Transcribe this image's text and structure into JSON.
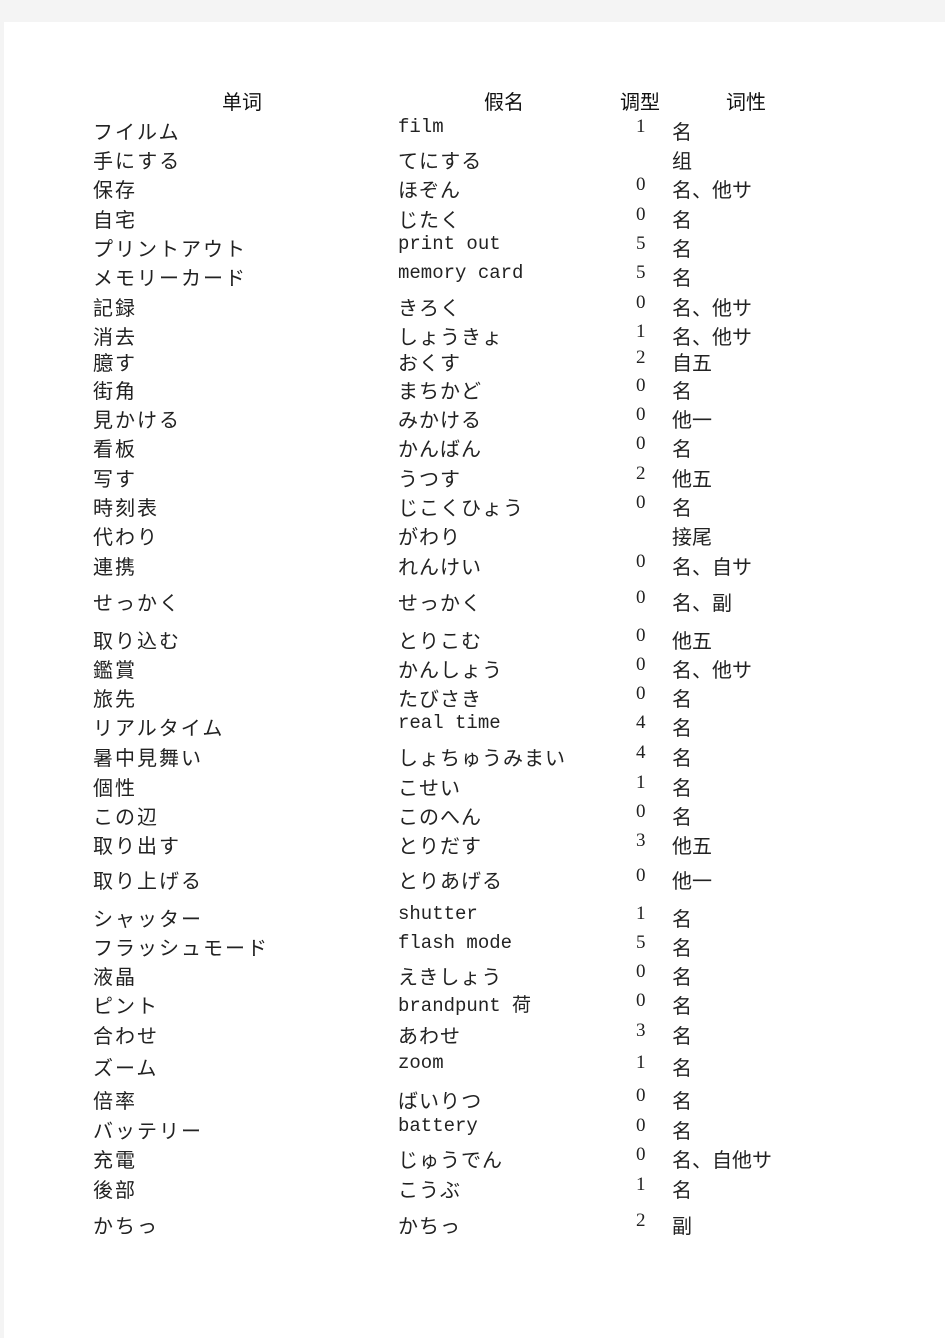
{
  "table": {
    "headers": {
      "word": "单词",
      "kana": "假名",
      "accent": "调型",
      "pos": "词性"
    },
    "rows": [
      {
        "word": "フイルム",
        "kana": "film",
        "accent": "1",
        "pos": "名"
      },
      {
        "word": "手にする",
        "kana": "てにする",
        "accent": "",
        "pos": "组"
      },
      {
        "word": "保存",
        "kana": "ほぞん",
        "accent": "0",
        "pos": "名、他サ"
      },
      {
        "word": "自宅",
        "kana": "じたく",
        "accent": "0",
        "pos": "名"
      },
      {
        "word": "プリントアウト",
        "kana": "print out",
        "accent": "5",
        "pos": "名"
      },
      {
        "word": "メモリーカード",
        "kana": "memory card",
        "accent": "5",
        "pos": "名"
      },
      {
        "word": "記録",
        "kana": "きろく",
        "accent": "0",
        "pos": "名、他サ"
      },
      {
        "word": "消去",
        "kana": "しょうきょ",
        "accent": "1",
        "pos": "名、他サ"
      },
      {
        "word": "臆す",
        "kana": "おくす",
        "accent": "2",
        "pos": "自五"
      },
      {
        "word": "街角",
        "kana": "まちかど",
        "accent": "0",
        "pos": "名"
      },
      {
        "word": "見かける",
        "kana": "みかける",
        "accent": "0",
        "pos": "他一"
      },
      {
        "word": "看板",
        "kana": "かんばん",
        "accent": "0",
        "pos": "名"
      },
      {
        "word": "写す",
        "kana": "うつす",
        "accent": "2",
        "pos": "他五"
      },
      {
        "word": "時刻表",
        "kana": "じこくひょう",
        "accent": "0",
        "pos": "名"
      },
      {
        "word": "代わり",
        "kana": "がわり",
        "accent": "",
        "pos": "接尾"
      },
      {
        "word": "連携",
        "kana": "れんけい",
        "accent": "0",
        "pos": "名、自サ"
      },
      {
        "word": "せっかく",
        "kana": "せっかく",
        "accent": "0",
        "pos": "名、副"
      },
      {
        "word": "取り込む",
        "kana": "とりこむ",
        "accent": "0",
        "pos": "他五"
      },
      {
        "word": "鑑賞",
        "kana": "かんしょう",
        "accent": "0",
        "pos": "名、他サ"
      },
      {
        "word": "旅先",
        "kana": "たびさき",
        "accent": "0",
        "pos": "名"
      },
      {
        "word": "リアルタイム",
        "kana": "real time",
        "accent": "4",
        "pos": "名"
      },
      {
        "word": "暑中見舞い",
        "kana": "しょちゅうみまい",
        "accent": "4",
        "pos": "名"
      },
      {
        "word": "個性",
        "kana": "こせい",
        "accent": "1",
        "pos": "名"
      },
      {
        "word": "この辺",
        "kana": "このへん",
        "accent": "0",
        "pos": "名"
      },
      {
        "word": "取り出す",
        "kana": "とりだす",
        "accent": "3",
        "pos": "他五"
      },
      {
        "word": "取り上げる",
        "kana": "とりあげる",
        "accent": "0",
        "pos": "他一"
      },
      {
        "word": "シャッター",
        "kana": "shutter",
        "accent": "1",
        "pos": "名"
      },
      {
        "word": "フラッシュモード",
        "kana": "flash mode",
        "accent": "5",
        "pos": "名"
      },
      {
        "word": "液晶",
        "kana": "えきしょう",
        "accent": "0",
        "pos": "名"
      },
      {
        "word": "ピント",
        "kana": "brandpunt 荷",
        "accent": "0",
        "pos": "名"
      },
      {
        "word": "合わせ",
        "kana": "あわせ",
        "accent": "3",
        "pos": "名"
      },
      {
        "word": "ズーム",
        "kana": "zoom",
        "accent": "1",
        "pos": "名"
      },
      {
        "word": "倍率",
        "kana": "ばいりつ",
        "accent": "0",
        "pos": "名"
      },
      {
        "word": "バッテリー",
        "kana": "battery",
        "accent": "0",
        "pos": "名"
      },
      {
        "word": "充電",
        "kana": "じゅうでん",
        "accent": "0",
        "pos": "名、自他サ"
      },
      {
        "word": "後部",
        "kana": "こうぶ",
        "accent": "1",
        "pos": "名"
      },
      {
        "word": "かちっ",
        "kana": "かちっ",
        "accent": "2",
        "pos": "副"
      }
    ]
  }
}
